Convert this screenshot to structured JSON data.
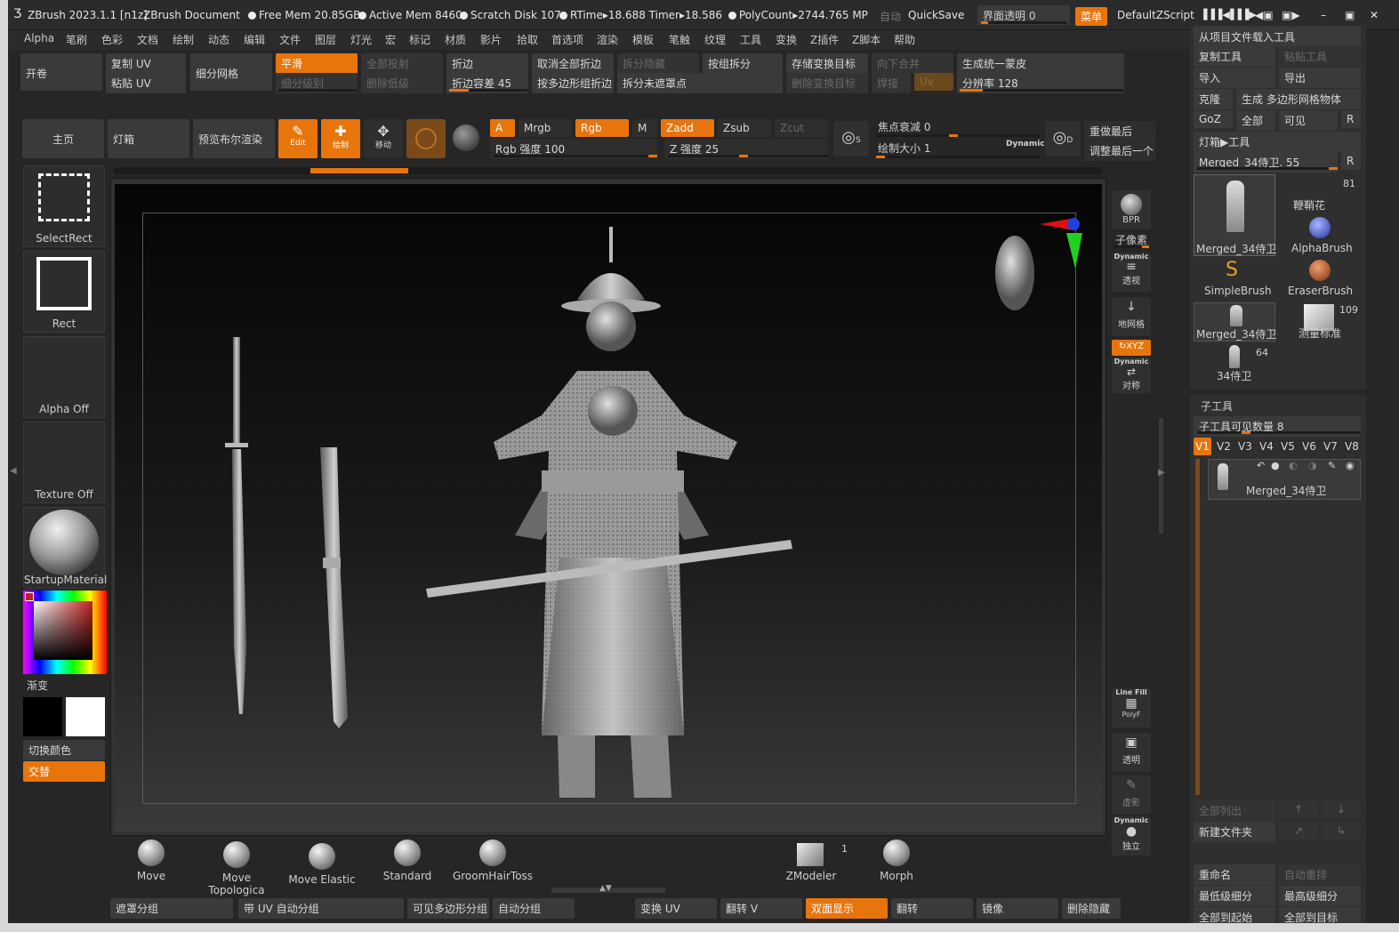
{
  "titlebar": {
    "app": "ZBrush 2023.1.1 [n1z]",
    "document": "ZBrush Document",
    "free_mem": "Free Mem 20.85GB",
    "active_mem": "Active Mem 8460",
    "scratch_disk": "Scratch Disk 107",
    "rtime": "RTime▸18.688 Timer▸18.586",
    "polycount": "PolyCount▸2744.765 MP",
    "auto": "自动",
    "quicksave": "QuickSave",
    "ui_transparency": "界面透明 0",
    "menu_btn": "菜单",
    "script": "DefaultZScript"
  },
  "menu": [
    "Alpha",
    "笔刷",
    "色彩",
    "文档",
    "绘制",
    "动态",
    "编辑",
    "文件",
    "图层",
    "灯光",
    "宏",
    "标记",
    "材质",
    "影片",
    "拾取",
    "首选项",
    "渲染",
    "模板",
    "笔触",
    "纹理",
    "工具",
    "变换",
    "Z插件",
    "Z脚本",
    "帮助"
  ],
  "shelf": {
    "open": "开卷",
    "copy_uv": "复制 UV",
    "paste_uv": "粘贴 UV",
    "subdiv_mesh": "细分网格",
    "smooth": "平滑",
    "subdiv_level": "细分级别",
    "project_all": "全部投射",
    "delete_lower": "删除低级",
    "crease": "折边",
    "crease_tol": "折边容差 45",
    "uncrease_all": "取消全部折边",
    "crease_pg": "按多边形组折边",
    "split_hidden": "拆分隐藏",
    "split_unmasked": "拆分未遮罩点",
    "group_split": "按组拆分",
    "store_morph": "存储变换目标",
    "delete_morph": "删除变换目标",
    "merge_down": "向下合并",
    "weld": "焊接",
    "uv": "Uv",
    "unified_skin": "生成统一蒙皮",
    "resolution": "分辨率 128"
  },
  "toolbar": {
    "home": "主页",
    "lightbox": "灯箱",
    "preview_boolean": "预览布尔渲染",
    "edit": "Edit",
    "draw": "绘制",
    "move": "移动",
    "a": "A",
    "mrgb": "Mrgb",
    "rgb": "Rgb",
    "m": "M",
    "zadd": "Zadd",
    "zsub": "Zsub",
    "zcut": "Zcut",
    "rgb_intensity": "Rgb 强度 100",
    "z_intensity": "Z 强度 25",
    "focal_shift": "焦点衰减 0",
    "draw_size": "绘制大小 1",
    "dynamic": "Dynamic",
    "replay_last": "重做最后",
    "adjust_last": "调整最后一个",
    "s": "S",
    "d": "D"
  },
  "left_panel": {
    "selectrect": "SelectRect",
    "rect": "Rect",
    "alpha_off": "Alpha Off",
    "texture_off": "Texture Off",
    "material": "StartupMaterial",
    "gradient": "渐变",
    "switch_color": "切换颜色",
    "alternate": "交替"
  },
  "right_strip": {
    "bpr": "BPR",
    "subpixel": "子像素",
    "dynamic": "Dynamic",
    "persp": "透视",
    "floor": "地网格",
    "xyz": "XYZ",
    "dynamic2": "Dynamic",
    "frame": "对称",
    "linefill": "Line Fill",
    "polyf": "PolyF",
    "transp": "透明",
    "ghost": "虚影",
    "dynamic3": "Dynamic",
    "solo": "独立"
  },
  "tool_panel": {
    "load_tool": "从项目文件载入工具",
    "copy_tool": "复制工具",
    "paste_tool": "粘贴工具",
    "import": "导入",
    "export": "导出",
    "clone": "克隆",
    "make_polymesh": "生成 多边形网格物体",
    "goz": "GoZ",
    "all": "全部",
    "visible": "可见",
    "r": "R",
    "lightbox_tools": "灯箱▶工具",
    "current_tool": "Merged_34侍卫. 55",
    "r2": "R",
    "thumbs": [
      {
        "label": "Merged_34侍卫",
        "count": ""
      },
      {
        "label": "鞭鞘花",
        "count": "81"
      },
      {
        "label": "AlphaBrush",
        "count": ""
      },
      {
        "label": "SimpleBrush",
        "count": ""
      },
      {
        "label": "EraserBrush",
        "count": ""
      },
      {
        "label": "Merged_34侍卫",
        "count": ""
      },
      {
        "label": "测量标准",
        "count": "109"
      },
      {
        "label": "34侍卫",
        "count": "64"
      }
    ]
  },
  "subtool": {
    "title": "子工具",
    "visible_count": "子工具可见数量 8",
    "versions": [
      "V1",
      "V2",
      "V3",
      "V4",
      "V5",
      "V6",
      "V7",
      "V8"
    ],
    "item": "Merged_34侍卫",
    "list_all": "全部列出",
    "new_folder": "新建文件夹",
    "rename": "重命名",
    "auto_reorder": "自动重排",
    "lowest_subdiv": "最低级细分",
    "highest_subdiv": "最高级细分",
    "all_to_start": "全部到起始",
    "all_to_target": "全部到目标"
  },
  "brushes": [
    {
      "name": "Move"
    },
    {
      "name": "Move Topologica"
    },
    {
      "name": "Move Elastic"
    },
    {
      "name": "Standard"
    },
    {
      "name": "GroomHairToss"
    },
    {
      "name": "ZModeler",
      "count": "1"
    },
    {
      "name": "Morph"
    }
  ],
  "bottom": {
    "mask_groups": "遮罩分组",
    "uv_autogroups": "带 UV 自动分组",
    "visible_polygroups": "可见多边形分组",
    "auto_groups": "自动分组",
    "flip_uv": "变换 UV",
    "flip_v": "翻转 V",
    "double": "双面显示",
    "flip": "翻转",
    "mirror": "镜像",
    "del_hidden": "删除隐藏"
  },
  "colors": {
    "accent": "#e8740c"
  }
}
